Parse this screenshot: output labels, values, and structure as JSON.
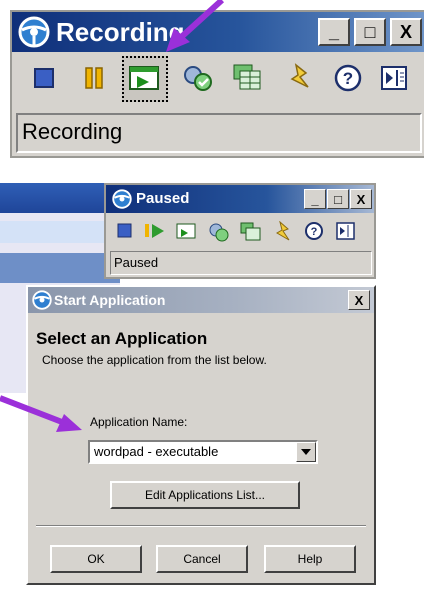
{
  "recorder": {
    "title": "Recording",
    "status": "Recording",
    "window_buttons": {
      "minimize": "_",
      "maximize": "□",
      "close": "X"
    }
  },
  "paused": {
    "title": "Paused",
    "status": "Paused",
    "window_buttons": {
      "minimize": "_",
      "maximize": "□",
      "close": "X"
    }
  },
  "dialog": {
    "title": "Start Application",
    "close": "X",
    "heading": "Select an Application",
    "subtitle": "Choose the application from the list below.",
    "app_name_label": "Application Name:",
    "selected_app": "wordpad - executable",
    "edit_button": "Edit Applications List...",
    "ok_button": "OK",
    "cancel_button": "Cancel",
    "help_button": "Help"
  },
  "colors": {
    "arrow": "#9b30d9",
    "titlebar_dark": "#0f2f7a",
    "face": "#d6d3ce"
  }
}
